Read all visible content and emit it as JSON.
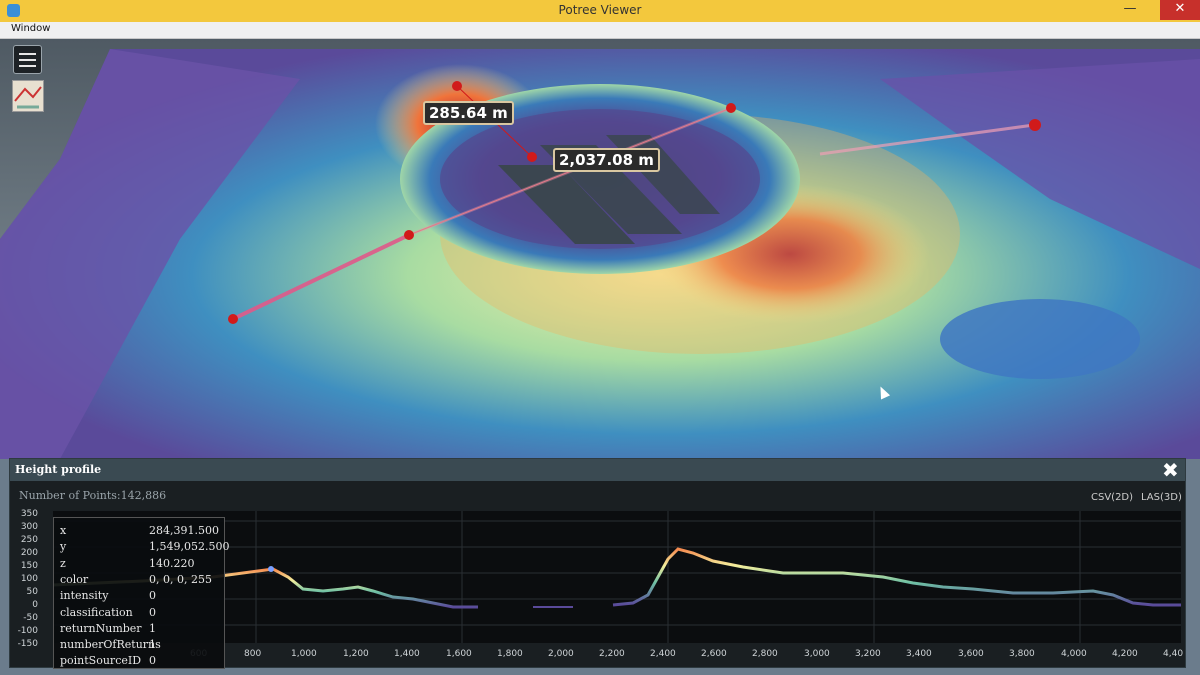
{
  "window": {
    "title": "Potree Viewer"
  },
  "menu": {
    "window": "Window"
  },
  "measurements": [
    {
      "label": "285.64 m"
    },
    {
      "label": "2,037.08 m"
    }
  ],
  "profile": {
    "title": "Height profile",
    "points": "Number of Points:142,886",
    "export_csv": "CSV(2D)",
    "export_las": "LAS(3D)",
    "y_ticks": [
      "350",
      "300",
      "250",
      "200",
      "150",
      "100",
      "50",
      "0",
      "-50",
      "-100",
      "-150"
    ],
    "x_ticks": [
      "600",
      "800",
      "1,000",
      "1,200",
      "1,400",
      "1,600",
      "1,800",
      "2,000",
      "2,200",
      "2,400",
      "2,600",
      "2,800",
      "3,000",
      "3,200",
      "3,400",
      "3,600",
      "3,800",
      "4,000",
      "4,200",
      "4,40"
    ],
    "info": [
      {
        "key": "x",
        "value": "284,391.500"
      },
      {
        "key": "y",
        "value": "1,549,052.500"
      },
      {
        "key": "z",
        "value": "140.220"
      },
      {
        "key": "color",
        "value": "0, 0, 0, 255"
      },
      {
        "key": "intensity",
        "value": "0"
      },
      {
        "key": "classification",
        "value": "0"
      },
      {
        "key": "returnNumber",
        "value": "1"
      },
      {
        "key": "numberOfReturns",
        "value": "1"
      },
      {
        "key": "pointSourceID",
        "value": "0"
      }
    ]
  },
  "colors": {
    "titlebar": "#f3c83d",
    "close": "#c7302b",
    "marker": "#d11a1a"
  }
}
